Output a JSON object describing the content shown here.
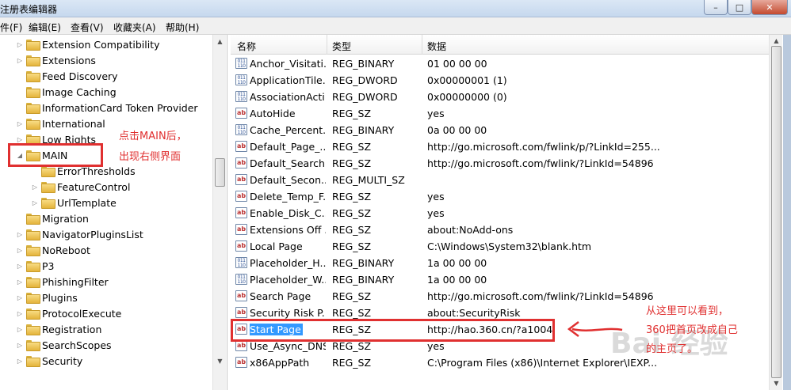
{
  "window": {
    "title": "注册表编辑器",
    "buttons": [
      "–",
      "□",
      "✕"
    ]
  },
  "menu": [
    "件(F)",
    "编辑(E)",
    "查看(V)",
    "收藏夹(A)",
    "帮助(H)"
  ],
  "tree": [
    {
      "label": "Extension Compatibility",
      "expand": "▷"
    },
    {
      "label": "Extensions",
      "expand": "▷"
    },
    {
      "label": "Feed Discovery",
      "expand": ""
    },
    {
      "label": "Image Caching",
      "expand": ""
    },
    {
      "label": "InformationCard Token Provider",
      "expand": ""
    },
    {
      "label": "International",
      "expand": "▷"
    },
    {
      "label": "Low Rights",
      "expand": "▷"
    },
    {
      "label": "MAIN",
      "expand": "◢"
    },
    {
      "label": "ErrorThresholds",
      "expand": ""
    },
    {
      "label": "FeatureControl",
      "expand": "▷"
    },
    {
      "label": "UrlTemplate",
      "expand": "▷"
    },
    {
      "label": "Migration",
      "expand": ""
    },
    {
      "label": "NavigatorPluginsList",
      "expand": "▷"
    },
    {
      "label": "NoReboot",
      "expand": "▷"
    },
    {
      "label": "P3",
      "expand": "▷"
    },
    {
      "label": "PhishingFilter",
      "expand": "▷"
    },
    {
      "label": "Plugins",
      "expand": "▷"
    },
    {
      "label": "ProtocolExecute",
      "expand": "▷"
    },
    {
      "label": "Registration",
      "expand": "▷"
    },
    {
      "label": "SearchScopes",
      "expand": "▷"
    },
    {
      "label": "Security",
      "expand": "▷"
    }
  ],
  "columns": {
    "name": "名称",
    "type": "类型",
    "data": "数据"
  },
  "values": [
    {
      "name": "Anchor_Visitati...",
      "type": "REG_BINARY",
      "data": "01 00 00 00",
      "icon": "binary-value-icon"
    },
    {
      "name": "ApplicationTile...",
      "type": "REG_DWORD",
      "data": "0x00000001 (1)",
      "icon": "binary-value-icon"
    },
    {
      "name": "AssociationActi...",
      "type": "REG_DWORD",
      "data": "0x00000000 (0)",
      "icon": "binary-value-icon"
    },
    {
      "name": "AutoHide",
      "type": "REG_SZ",
      "data": "yes",
      "icon": "string-value-icon"
    },
    {
      "name": "Cache_Percent...",
      "type": "REG_BINARY",
      "data": "0a 00 00 00",
      "icon": "binary-value-icon"
    },
    {
      "name": "Default_Page_...",
      "type": "REG_SZ",
      "data": "http://go.microsoft.com/fwlink/p/?LinkId=255...",
      "icon": "string-value-icon"
    },
    {
      "name": "Default_Search...",
      "type": "REG_SZ",
      "data": "http://go.microsoft.com/fwlink/?LinkId=54896",
      "icon": "string-value-icon"
    },
    {
      "name": "Default_Secon...",
      "type": "REG_MULTI_SZ",
      "data": "",
      "icon": "string-value-icon"
    },
    {
      "name": "Delete_Temp_F...",
      "type": "REG_SZ",
      "data": "yes",
      "icon": "string-value-icon"
    },
    {
      "name": "Enable_Disk_C...",
      "type": "REG_SZ",
      "data": "yes",
      "icon": "string-value-icon"
    },
    {
      "name": "Extensions Off ...",
      "type": "REG_SZ",
      "data": "about:NoAdd-ons",
      "icon": "string-value-icon"
    },
    {
      "name": "Local Page",
      "type": "REG_SZ",
      "data": "C:\\Windows\\System32\\blank.htm",
      "icon": "string-value-icon"
    },
    {
      "name": "Placeholder_H...",
      "type": "REG_BINARY",
      "data": "1a 00 00 00",
      "icon": "binary-value-icon"
    },
    {
      "name": "Placeholder_W...",
      "type": "REG_BINARY",
      "data": "1a 00 00 00",
      "icon": "binary-value-icon"
    },
    {
      "name": "Search Page",
      "type": "REG_SZ",
      "data": "http://go.microsoft.com/fwlink/?LinkId=54896",
      "icon": "string-value-icon"
    },
    {
      "name": "Security Risk P...",
      "type": "REG_SZ",
      "data": "about:SecurityRisk",
      "icon": "string-value-icon"
    },
    {
      "name": "Start Page",
      "type": "REG_SZ",
      "data": "http://hao.360.cn/?a1004",
      "icon": "string-value-icon",
      "selected": true
    },
    {
      "name": "Use_Async_DNS",
      "type": "REG_SZ",
      "data": "yes",
      "icon": "string-value-icon"
    },
    {
      "name": "x86AppPath",
      "type": "REG_SZ",
      "data": "C:\\Program Files (x86)\\Internet Explorer\\IEXP...",
      "icon": "string-value-icon"
    }
  ],
  "annotations": {
    "left_line1": "点击MAIN后，",
    "left_line2": "出现右侧界面",
    "right_line1": "从这里可以看到，",
    "right_line2": "360把首页改成自己",
    "right_line3": "的主页了。",
    "color": "#e03030"
  },
  "watermark": "Bai 经验"
}
